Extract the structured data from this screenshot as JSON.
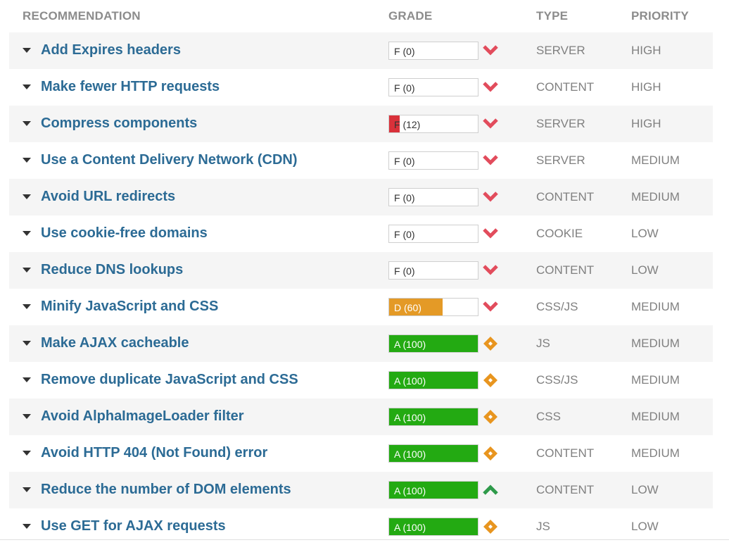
{
  "header": {
    "recommendation": "RECOMMENDATION",
    "grade": "GRADE",
    "type": "TYPE",
    "priority": "PRIORITY"
  },
  "colors": {
    "fail": "#e24c5c",
    "fail_fill": "#d9313a",
    "warn_fill": "#e49a26",
    "pass_fill": "#23aa12",
    "neutral": "#e8951f",
    "good": "#2e9a4a"
  },
  "rows": [
    {
      "title": "Add Expires headers",
      "grade": "F (0)",
      "score": 0,
      "status": "chevron-down-icon",
      "type": "SERVER",
      "priority": "HIGH"
    },
    {
      "title": "Make fewer HTTP requests",
      "grade": "F (0)",
      "score": 0,
      "status": "chevron-down-icon",
      "type": "CONTENT",
      "priority": "HIGH"
    },
    {
      "title": "Compress components",
      "grade": "F (12)",
      "score": 12,
      "status": "chevron-down-icon",
      "type": "SERVER",
      "priority": "HIGH"
    },
    {
      "title": "Use a Content Delivery Network (CDN)",
      "grade": "F (0)",
      "score": 0,
      "status": "chevron-down-icon",
      "type": "SERVER",
      "priority": "MEDIUM"
    },
    {
      "title": "Avoid URL redirects",
      "grade": "F (0)",
      "score": 0,
      "status": "chevron-down-icon",
      "type": "CONTENT",
      "priority": "MEDIUM"
    },
    {
      "title": "Use cookie-free domains",
      "grade": "F (0)",
      "score": 0,
      "status": "chevron-down-icon",
      "type": "COOKIE",
      "priority": "LOW"
    },
    {
      "title": "Reduce DNS lookups",
      "grade": "F (0)",
      "score": 0,
      "status": "chevron-down-icon",
      "type": "CONTENT",
      "priority": "LOW"
    },
    {
      "title": "Minify JavaScript and CSS",
      "grade": "D (60)",
      "score": 60,
      "status": "chevron-down-icon",
      "type": "CSS/JS",
      "priority": "MEDIUM"
    },
    {
      "title": "Make AJAX cacheable",
      "grade": "A (100)",
      "score": 100,
      "status": "diamond-icon",
      "type": "JS",
      "priority": "MEDIUM"
    },
    {
      "title": "Remove duplicate JavaScript and CSS",
      "grade": "A (100)",
      "score": 100,
      "status": "diamond-icon",
      "type": "CSS/JS",
      "priority": "MEDIUM"
    },
    {
      "title": "Avoid AlphaImageLoader filter",
      "grade": "A (100)",
      "score": 100,
      "status": "diamond-icon",
      "type": "CSS",
      "priority": "MEDIUM"
    },
    {
      "title": "Avoid HTTP 404 (Not Found) error",
      "grade": "A (100)",
      "score": 100,
      "status": "diamond-icon",
      "type": "CONTENT",
      "priority": "MEDIUM"
    },
    {
      "title": "Reduce the number of DOM elements",
      "grade": "A (100)",
      "score": 100,
      "status": "chevron-up-icon",
      "type": "CONTENT",
      "priority": "LOW"
    },
    {
      "title": "Use GET for AJAX requests",
      "grade": "A (100)",
      "score": 100,
      "status": "diamond-icon",
      "type": "JS",
      "priority": "LOW"
    }
  ]
}
